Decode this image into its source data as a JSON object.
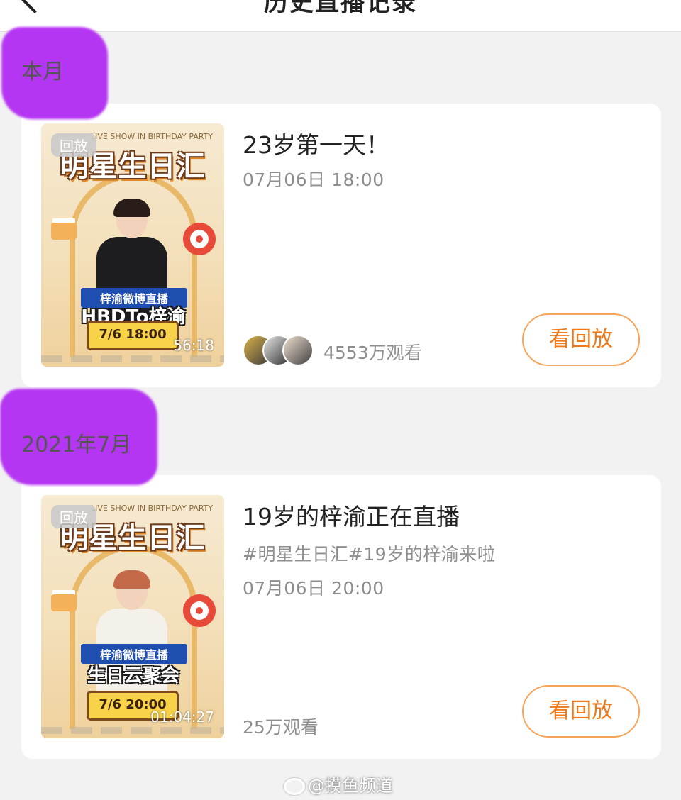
{
  "header": {
    "title": "历史直播记录"
  },
  "sections": [
    {
      "label": "本月",
      "item": {
        "badge": "回放",
        "duration": "56:18",
        "title": "23岁第一天！",
        "time": "07月06日 18:00",
        "viewers": "4553万观看",
        "replay_label": "看回放",
        "poster": {
          "top_text": "LIVE SHOW IN BIRTHDAY PARTY",
          "headline": "明星生日汇",
          "sub": "梓渝微博直播",
          "main": "HBDTo梓渝",
          "date": "7/6 18:00"
        }
      }
    },
    {
      "label": "2021年7月",
      "item": {
        "badge": "回放",
        "duration": "01:04:27",
        "title": "19岁的梓渝正在直播",
        "tags": "#明星生日汇#19岁的梓渝来啦",
        "time": "07月06日 20:00",
        "viewers": "25万观看",
        "replay_label": "看回放",
        "poster": {
          "top_text": "LIVE SHOW IN BIRTHDAY PARTY",
          "headline": "明星生日汇",
          "sub": "梓渝微博直播",
          "main": "生日云聚会",
          "date": "7/6 20:00"
        }
      }
    }
  ],
  "watermark": "@摸鱼频道",
  "colors": {
    "accent": "#f07a1b",
    "highlight": "#b536f2",
    "meta_text": "#8e8e8e",
    "background": "#f2f2f2"
  }
}
